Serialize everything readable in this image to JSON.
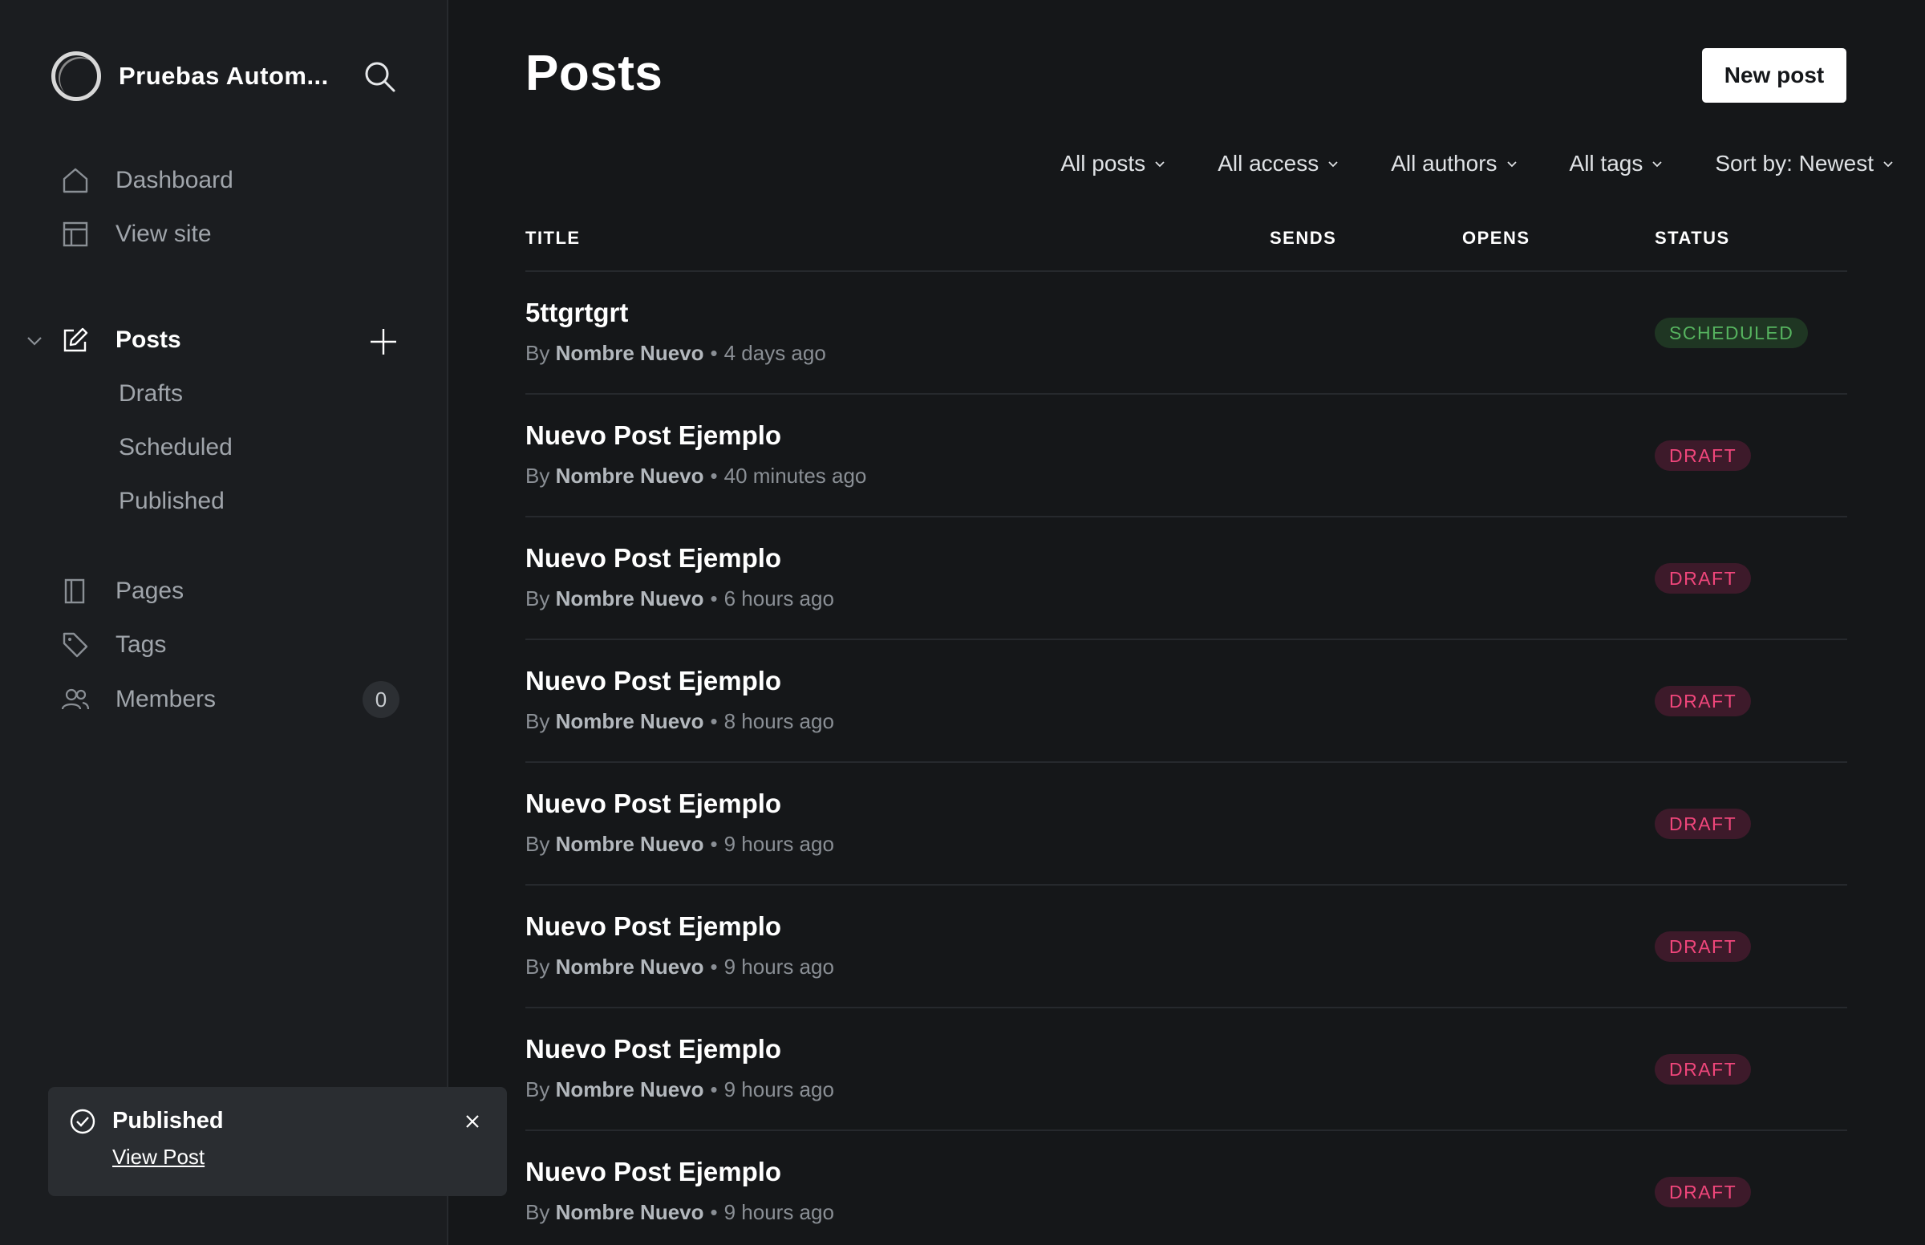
{
  "site": {
    "name": "Pruebas Autom..."
  },
  "nav": {
    "dashboard": "Dashboard",
    "view_site": "View site",
    "posts": "Posts",
    "drafts": "Drafts",
    "scheduled": "Scheduled",
    "published": "Published",
    "pages": "Pages",
    "tags": "Tags",
    "members": "Members",
    "members_count": "0"
  },
  "page": {
    "title": "Posts",
    "new_post_label": "New post"
  },
  "filters": {
    "type": "All posts",
    "access": "All access",
    "authors": "All authors",
    "tags": "All tags",
    "sort": "Sort by: Newest"
  },
  "table": {
    "columns": {
      "title": "TITLE",
      "sends": "SENDS",
      "opens": "OPENS",
      "status": "STATUS"
    },
    "rows": [
      {
        "title": "5ttgrtgrt",
        "by": "By",
        "author": "Nombre Nuevo",
        "time": "4 days ago",
        "status": "SCHEDULED"
      },
      {
        "title": "Nuevo Post Ejemplo",
        "by": "By",
        "author": "Nombre Nuevo",
        "time": "40 minutes ago",
        "status": "DRAFT"
      },
      {
        "title": "Nuevo Post Ejemplo",
        "by": "By",
        "author": "Nombre Nuevo",
        "time": "6 hours ago",
        "status": "DRAFT"
      },
      {
        "title": "Nuevo Post Ejemplo",
        "by": "By",
        "author": "Nombre Nuevo",
        "time": "8 hours ago",
        "status": "DRAFT"
      },
      {
        "title": "Nuevo Post Ejemplo",
        "by": "By",
        "author": "Nombre Nuevo",
        "time": "9 hours ago",
        "status": "DRAFT"
      },
      {
        "title": "Nuevo Post Ejemplo",
        "by": "By",
        "author": "Nombre Nuevo",
        "time": "9 hours ago",
        "status": "DRAFT"
      },
      {
        "title": "Nuevo Post Ejemplo",
        "by": "By",
        "author": "Nombre Nuevo",
        "time": "9 hours ago",
        "status": "DRAFT"
      },
      {
        "title": "Nuevo Post Ejemplo",
        "by": "By",
        "author": "Nombre Nuevo",
        "time": "9 hours ago",
        "status": "DRAFT"
      }
    ]
  },
  "toast": {
    "title": "Published",
    "link": "View Post"
  },
  "colors": {
    "background": "#151719",
    "sidebar": "#1b1d20",
    "draft_text": "#f0467b",
    "draft_bg": "#3d1a2a",
    "scheduled_text": "#56b35f",
    "scheduled_bg": "#1f3623"
  },
  "icons": {
    "search": "search-icon",
    "dashboard": "home-icon",
    "view_site": "layout-icon",
    "posts": "edit-icon",
    "pages": "page-icon",
    "tags": "tag-icon",
    "members": "users-icon",
    "add": "plus-icon",
    "toast": "check-circle-icon",
    "close": "close-icon"
  }
}
